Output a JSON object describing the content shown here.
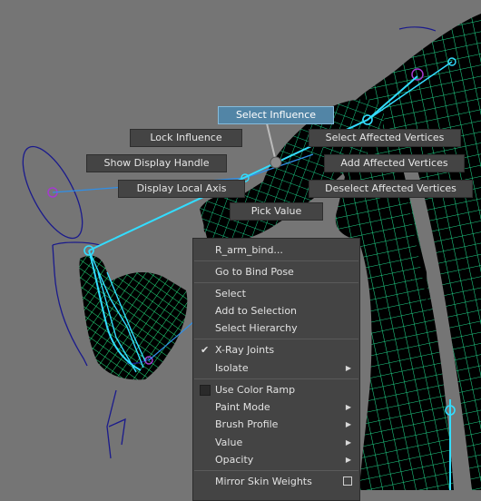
{
  "marking_menu": {
    "select_influence": "Select Influence",
    "lock_influence": "Lock Influence",
    "show_display_handle": "Show Display Handle",
    "display_local_axis": "Display Local Axis",
    "pick_value": "Pick Value",
    "select_affected_vertices": "Select Affected Vertices",
    "add_affected_vertices": "Add Affected Vertices",
    "deselect_affected_vertices": "Deselect Affected Vertices",
    "highlight_color": "#5285a6"
  },
  "context_menu": {
    "joint_name": "R_arm_bind...",
    "go_to_bind_pose": "Go to Bind Pose",
    "select": "Select",
    "add_to_selection": "Add to Selection",
    "select_hierarchy": "Select Hierarchy",
    "xray_joints": "X-Ray Joints",
    "xray_joints_checked": true,
    "isolate": "Isolate",
    "use_color_ramp": "Use Color Ramp",
    "paint_mode": "Paint Mode",
    "brush_profile": "Brush Profile",
    "value": "Value",
    "opacity": "Opacity",
    "mirror_skin_weights": "Mirror Skin Weights",
    "check_glyph": "✔",
    "submenu_glyph": "▶"
  },
  "viewport": {
    "background_color": "#757575",
    "wire_color": "#00ff9c",
    "joint_color": "#33ddff",
    "skin_color": "#000000",
    "curve_color": "#1a1a8c"
  }
}
